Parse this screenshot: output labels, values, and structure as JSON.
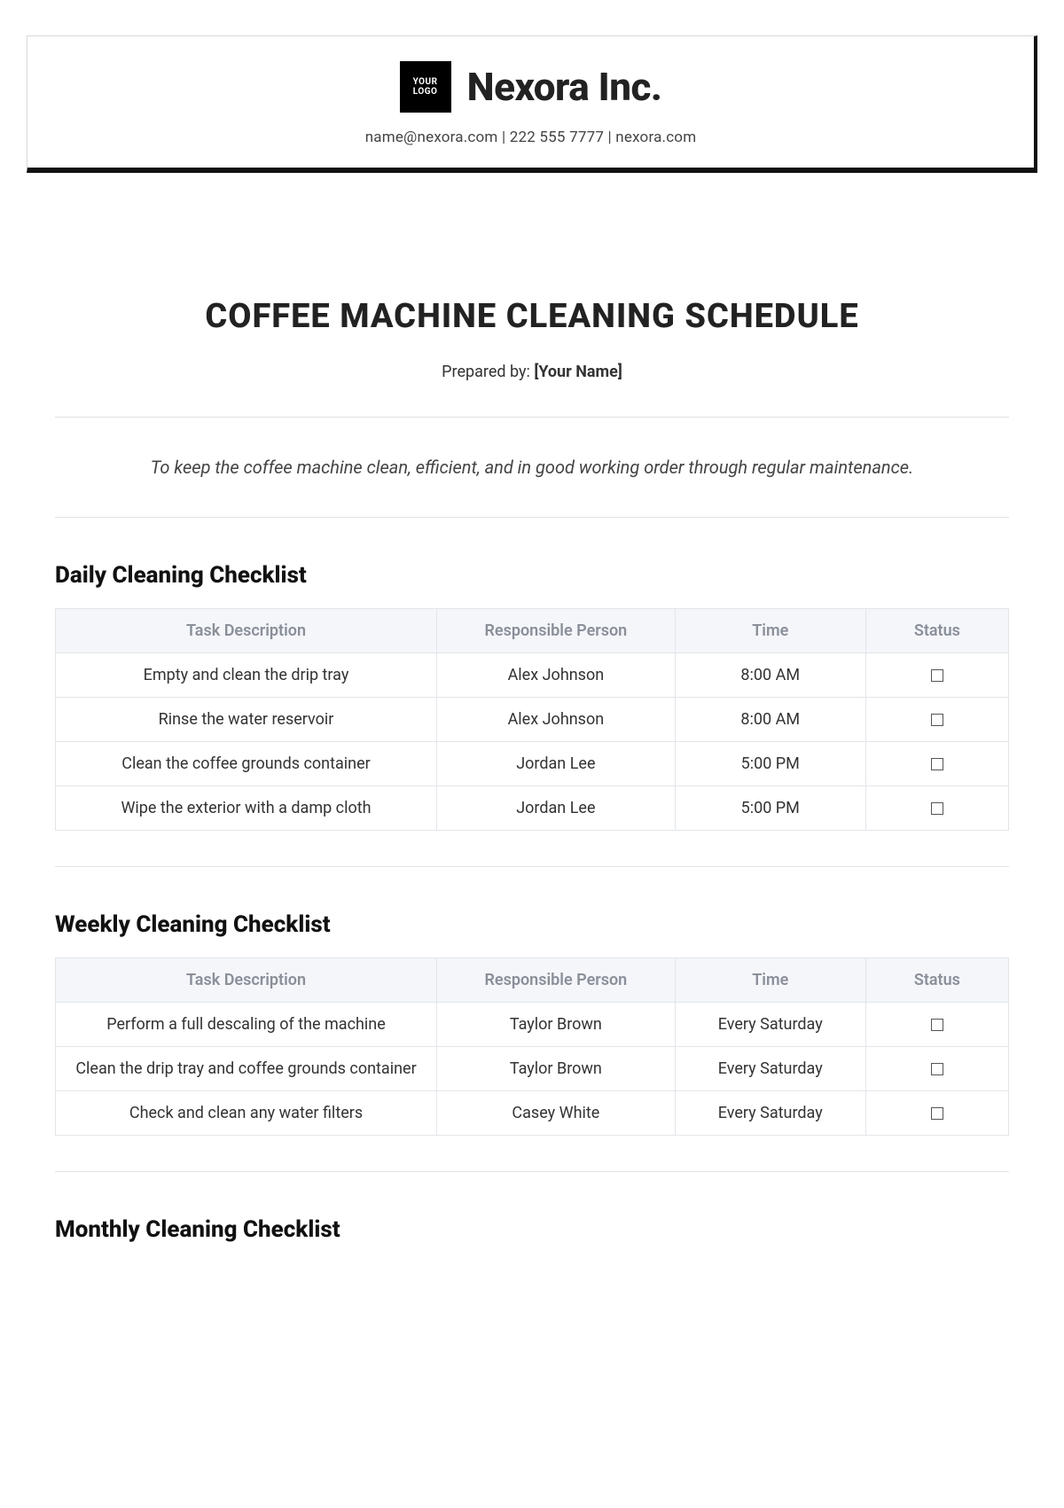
{
  "header": {
    "logo_text": "YOUR\nLOGO",
    "company": "Nexora Inc.",
    "contact": "name@nexora.com | 222 555 7777 | nexora.com"
  },
  "title": "COFFEE MACHINE CLEANING SCHEDULE",
  "prepared_label": "Prepared by: ",
  "prepared_placeholder": "[Your Name]",
  "purpose": "To keep the coffee machine clean, efficient, and in good working order through regular maintenance.",
  "columns": {
    "task": "Task Description",
    "person": "Responsible Person",
    "time": "Time",
    "status": "Status"
  },
  "sections": {
    "daily": {
      "title": "Daily Cleaning Checklist",
      "rows": [
        {
          "task": "Empty and clean the drip tray",
          "person": "Alex Johnson",
          "time": "8:00 AM"
        },
        {
          "task": "Rinse the water reservoir",
          "person": "Alex Johnson",
          "time": "8:00 AM"
        },
        {
          "task": "Clean the coffee grounds container",
          "person": "Jordan Lee",
          "time": "5:00 PM"
        },
        {
          "task": "Wipe the exterior with a damp cloth",
          "person": "Jordan Lee",
          "time": "5:00 PM"
        }
      ]
    },
    "weekly": {
      "title": "Weekly Cleaning Checklist",
      "rows": [
        {
          "task": "Perform a full descaling of the machine",
          "person": "Taylor Brown",
          "time": "Every Saturday"
        },
        {
          "task": "Clean the drip tray and coffee grounds container",
          "person": "Taylor Brown",
          "time": "Every Saturday"
        },
        {
          "task": "Check and clean any water filters",
          "person": "Casey White",
          "time": "Every Saturday"
        }
      ]
    },
    "monthly": {
      "title": "Monthly Cleaning Checklist"
    }
  }
}
